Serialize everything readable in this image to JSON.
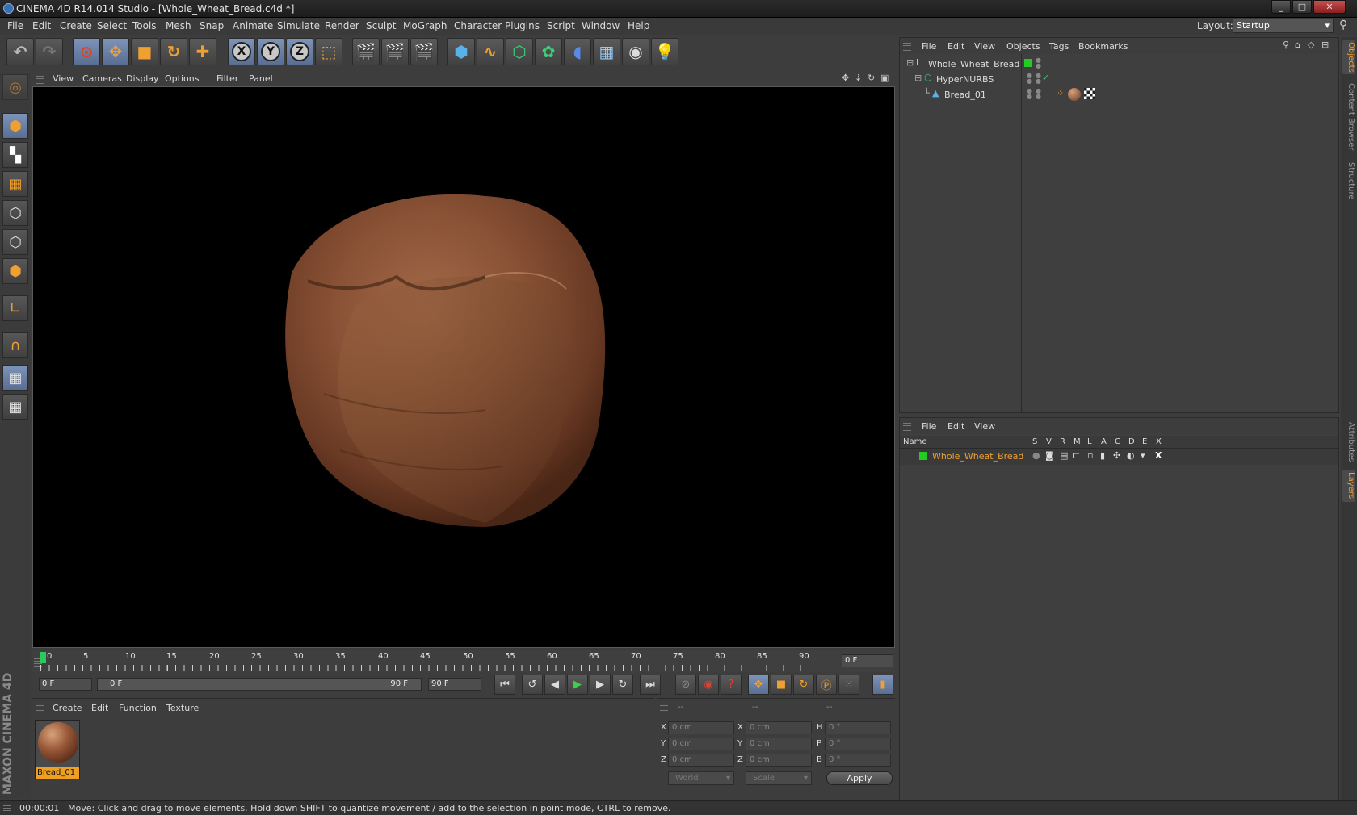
{
  "window": {
    "title": "CINEMA 4D R14.014 Studio - [Whole_Wheat_Bread.c4d *]",
    "minimize": "_",
    "maximize": "□",
    "close": "✕"
  },
  "menubar": {
    "items": [
      "File",
      "Edit",
      "Create",
      "Select",
      "Tools",
      "Mesh",
      "Snap",
      "Animate",
      "Simulate",
      "Render",
      "Sculpt",
      "MoGraph",
      "Character",
      "Plugins",
      "Script",
      "Window",
      "Help"
    ],
    "layout_label": "Layout:",
    "layout_value": "Startup"
  },
  "toolbar": {
    "axis_x": "X",
    "axis_y": "Y",
    "axis_z": "Z"
  },
  "viewport": {
    "menu": [
      "View",
      "Cameras",
      "Display",
      "Options",
      "Filter",
      "Panel"
    ]
  },
  "timeline": {
    "ticks": [
      "0",
      "5",
      "10",
      "15",
      "20",
      "25",
      "30",
      "35",
      "40",
      "45",
      "50",
      "55",
      "60",
      "65",
      "70",
      "75",
      "80",
      "85",
      "90"
    ],
    "frame_field": "0 F"
  },
  "transport": {
    "start_field": "0 F",
    "range_start": "0 F",
    "range_end": "90 F",
    "end_field": "90 F"
  },
  "material_manager": {
    "menu": [
      "Create",
      "Edit",
      "Function",
      "Texture"
    ],
    "materials": [
      {
        "name": "Bread_01"
      }
    ]
  },
  "coordinates": {
    "headers": [
      "--",
      "--",
      "--"
    ],
    "rows": [
      {
        "a": "X",
        "av": "0 cm",
        "b": "X",
        "bv": "0 cm",
        "c": "H",
        "cv": "0 °"
      },
      {
        "a": "Y",
        "av": "0 cm",
        "b": "Y",
        "bv": "0 cm",
        "c": "P",
        "cv": "0 °"
      },
      {
        "a": "Z",
        "av": "0 cm",
        "b": "Z",
        "bv": "0 cm",
        "c": "B",
        "cv": "0 °"
      }
    ],
    "space": "World",
    "mode": "Scale",
    "apply": "Apply"
  },
  "object_manager": {
    "menu": [
      "File",
      "Edit",
      "View",
      "Objects",
      "Tags",
      "Bookmarks"
    ],
    "objects": [
      {
        "name": "Whole_Wheat_Bread"
      },
      {
        "name": "HyperNURBS"
      },
      {
        "name": "Bread_01"
      }
    ]
  },
  "layer_manager": {
    "menu": [
      "File",
      "Edit",
      "View"
    ],
    "columns": [
      "Name",
      "S",
      "V",
      "R",
      "M",
      "L",
      "A",
      "G",
      "D",
      "E",
      "X"
    ],
    "layers": [
      {
        "name": "Whole_Wheat_Bread"
      }
    ]
  },
  "right_tabs": [
    "Objects",
    "Content Browser",
    "Structure",
    "Attributes",
    "Layers"
  ],
  "status": {
    "time": "00:00:01",
    "message": "Move: Click and drag to move elements. Hold down SHIFT to quantize movement / add to the selection in point mode, CTRL to remove."
  },
  "brand": "MAXON CINEMA 4D",
  "colors": {
    "accent": "#f0a030",
    "active": "#6a80a8",
    "layer_green": "#22cc22"
  }
}
